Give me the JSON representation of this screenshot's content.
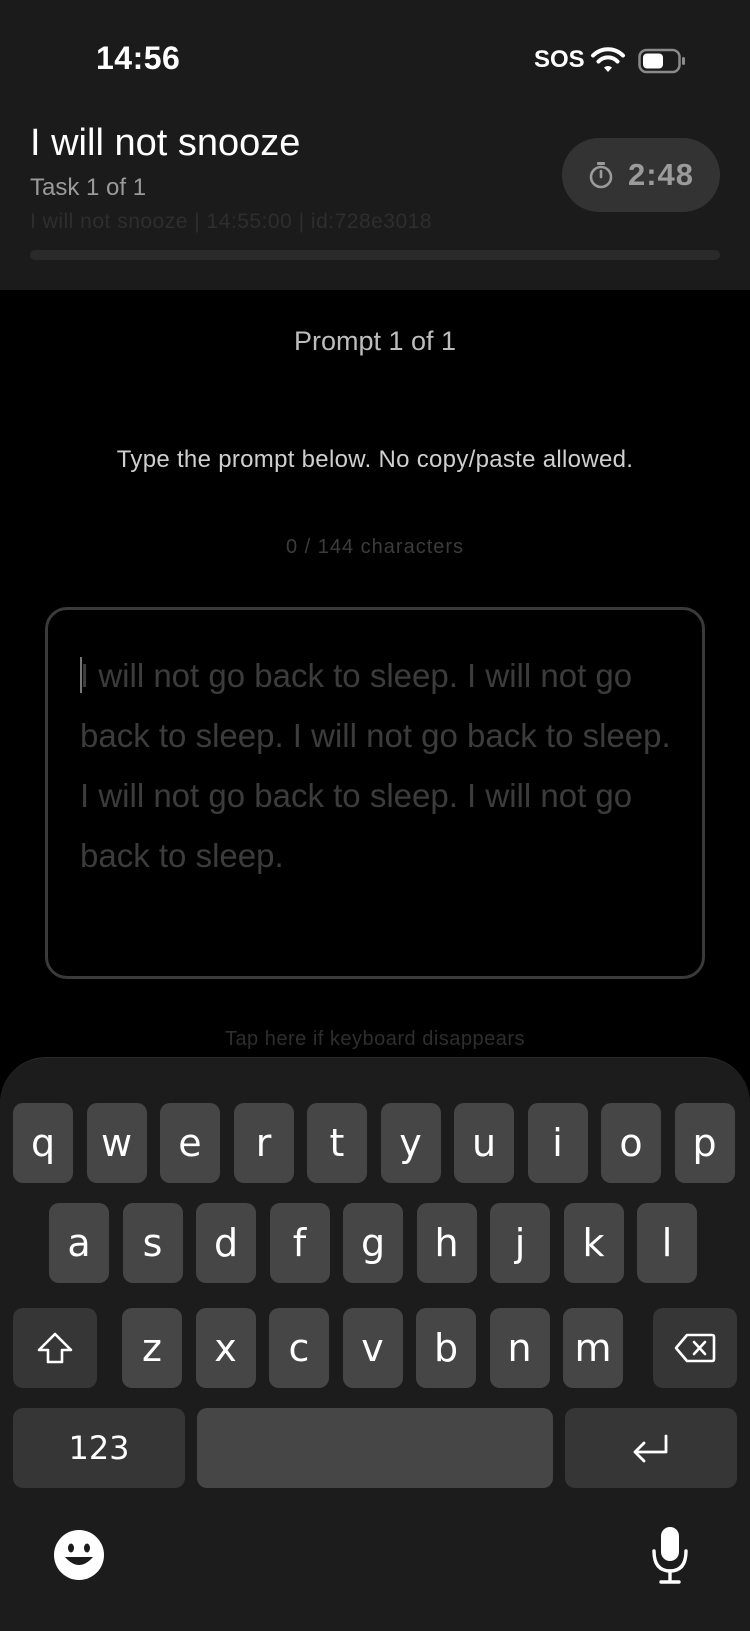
{
  "status_bar": {
    "time": "14:56",
    "carrier": "SOS"
  },
  "header": {
    "title": "I will not snooze",
    "subtitle": "Task 1 of 1",
    "debug_line": "I will not snooze | 14:55:00 | id:728e3018",
    "timer": "2:48",
    "progress": 0
  },
  "prompt": {
    "counter": "Prompt 1 of 1",
    "instructions": "Type the prompt below. No copy/paste allowed.",
    "char_count": "0 / 144 characters",
    "placeholder": "I will not go back to sleep. I will not go back to sleep. I will not go back to sleep. I will not go back to sleep. I will not go back to sleep.",
    "tap_hint": "Tap here if keyboard disappears"
  },
  "keyboard": {
    "row1": [
      "q",
      "w",
      "e",
      "r",
      "t",
      "y",
      "u",
      "i",
      "o",
      "p"
    ],
    "row2": [
      "a",
      "s",
      "d",
      "f",
      "g",
      "h",
      "j",
      "k",
      "l"
    ],
    "row3": [
      "z",
      "x",
      "c",
      "v",
      "b",
      "n",
      "m"
    ],
    "numbers_label": "123",
    "icons": {
      "shift": "shift-icon",
      "delete": "delete-icon",
      "return": "return-icon",
      "emoji": "emoji-icon",
      "mic": "microphone-icon"
    }
  },
  "colors": {
    "background": "#000000",
    "header_bg": "#1b1b1b",
    "key_bg": "#464646",
    "keyboard_bg": "#1c1c1c"
  }
}
